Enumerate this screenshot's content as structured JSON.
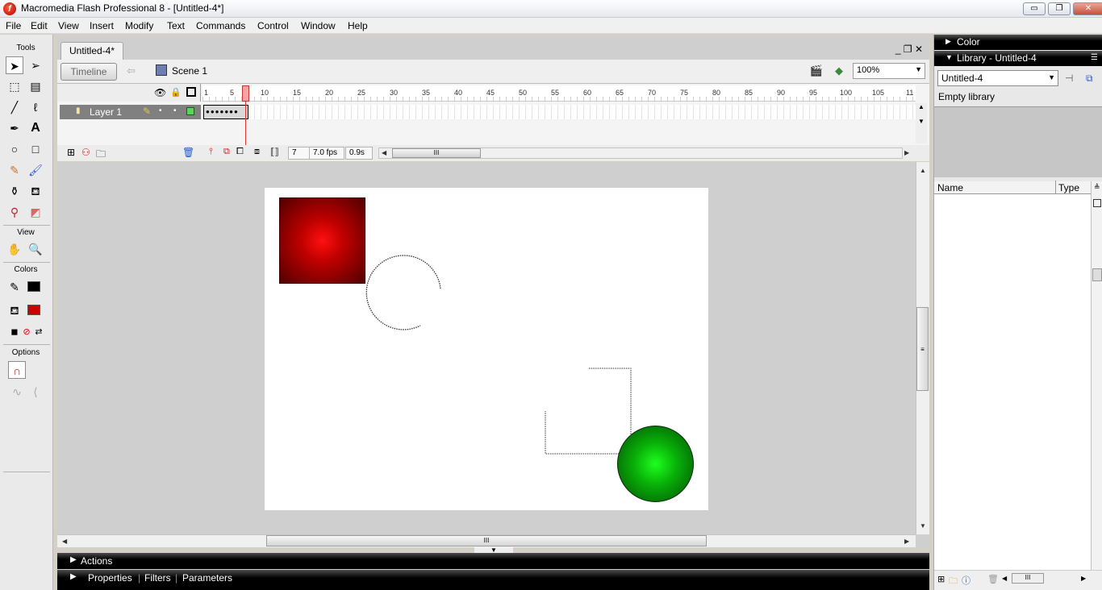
{
  "window": {
    "title": "Macromedia Flash Professional 8 - [Untitled-4*]",
    "controls": {
      "minimize": "▭",
      "restore": "❐",
      "close": "✕"
    }
  },
  "menu": [
    "File",
    "Edit",
    "View",
    "Insert",
    "Modify",
    "Text",
    "Commands",
    "Control",
    "Window",
    "Help"
  ],
  "tools": {
    "title": "Tools",
    "view_label": "View",
    "colors_label": "Colors",
    "options_label": "Options",
    "stroke_color": "#000000",
    "fill_color": "#cc0000",
    "selected": "selection-tool"
  },
  "document": {
    "tab_label": "Untitled-4*",
    "doc_controls": "_  ❐  ✕",
    "timeline_button": "Timeline",
    "scene_label": "Scene 1",
    "zoom": "100%"
  },
  "timeline": {
    "ruler": [
      "1",
      "5",
      "10",
      "15",
      "20",
      "25",
      "30",
      "35",
      "40",
      "45",
      "50",
      "55",
      "60",
      "65",
      "70",
      "75",
      "80",
      "85",
      "90",
      "95",
      "100",
      "105",
      "11"
    ],
    "layer_name": "Layer 1",
    "keyframes": "●●●●●●●",
    "current_frame": "7",
    "frame_rate": "7.0 fps",
    "elapsed": "0.9s"
  },
  "panels": {
    "actions": "Actions",
    "properties": "Properties",
    "filters": "Filters",
    "parameters": "Parameters"
  },
  "right": {
    "color_title": "Color",
    "library_title": "Library - Untitled-4",
    "library_select": "Untitled-4",
    "empty_text": "Empty library",
    "col_name": "Name",
    "col_type": "Type"
  }
}
